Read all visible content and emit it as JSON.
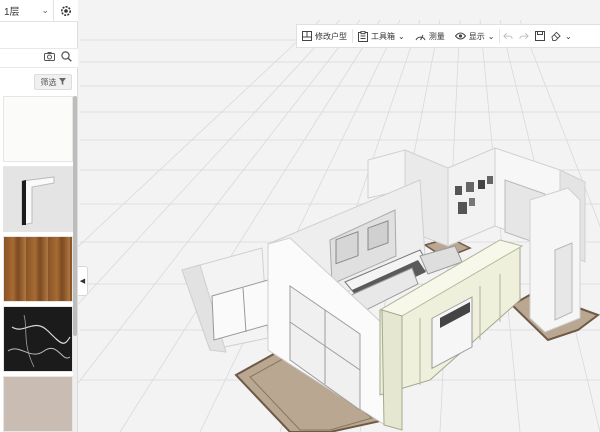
{
  "floor": {
    "selected": "1层"
  },
  "toolbar": {
    "edit_layout": "修改户型",
    "toolbox": "工具箱",
    "measure": "测量",
    "display": "显示"
  },
  "sidebar": {
    "filter_label": "筛选"
  },
  "colors": {
    "accent": "#2f2f2f",
    "panel_bg": "#ffffff",
    "grid_bg": "#f3f3f4"
  }
}
